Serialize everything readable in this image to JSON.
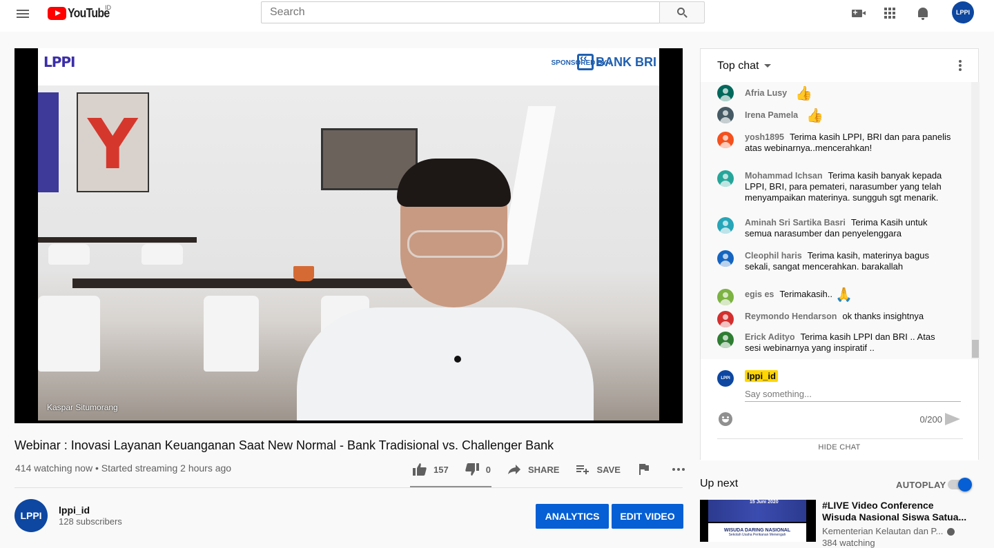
{
  "masthead": {
    "logo_text": "YouTube",
    "country_code": "ID",
    "search_placeholder": "Search",
    "avatar_text": "LPPI"
  },
  "player": {
    "banner_logo": "LPPI",
    "sponsor_label": "SPONSORED BY :",
    "sponsor_name": "BANK BRI",
    "speaker_name": "Kaspar Situmorang"
  },
  "video": {
    "title": "Webinar : Inovasi Layanan Keuanganan Saat New Normal - Bank Tradisional vs. Challenger Bank",
    "meta": "414 watching now • Started streaming 2 hours ago",
    "likes": "157",
    "dislikes": "0",
    "share_label": "SHARE",
    "save_label": "SAVE",
    "like_ratio": 1.0
  },
  "channel": {
    "avatar_text": "LPPI",
    "name": "lppi_id",
    "subscribers": "128 subscribers",
    "analytics_label": "ANALYTICS",
    "edit_label": "EDIT VIDEO"
  },
  "chat": {
    "title": "Top chat",
    "messages": [
      {
        "author": "Afria Lusy",
        "text": "",
        "emoji": "👍",
        "color": "#00695c"
      },
      {
        "author": "Irena Pamela",
        "text": "",
        "emoji": "👍",
        "color": "#455a64"
      },
      {
        "author": "yosh1895",
        "text": "Terima kasih LPPI, BRI dan para panelis atas webinarnya..mencerahkan!",
        "emoji": "",
        "color": "#f4511e"
      },
      {
        "author": "Mohammad Ichsan",
        "text": "Terima kasih banyak kepada LPPI, BRI, para pemateri, narasumber yang telah menyampaikan materinya. sungguh sgt menarik.",
        "emoji": "",
        "color": "#26a69a"
      },
      {
        "author": "Aminah Sri Sartika Basri",
        "text": "Terima Kasih untuk semua narasumber dan penyelenggara",
        "emoji": "",
        "color": "#26a6b8"
      },
      {
        "author": "Cleophil haris",
        "text": "Terima kasih, materinya bagus sekali, sangat mencerahkan. barakallah",
        "emoji": "",
        "color": "#1565c0"
      },
      {
        "author": "egis es",
        "text": "Terimakasih..",
        "emoji": "🙏",
        "color": "#7cb342"
      },
      {
        "author": "Reymondo Hendarson",
        "text": "ok thanks insightnya",
        "emoji": "",
        "color": "#d32f2f"
      },
      {
        "author": "Erick Adityo",
        "text": "Terima kasih LPPI dan BRI .. Atas sesi webinarnya yang inspiratif ..",
        "emoji": "",
        "color": "#2e7d32"
      }
    ],
    "input": {
      "avatar_text": "LPPI",
      "user_name": "lppi_id",
      "placeholder": "Say something...",
      "counter": "0/200"
    },
    "hide_chat_label": "HIDE CHAT"
  },
  "up_next": {
    "label": "Up next",
    "autoplay_label": "AUTOPLAY",
    "autoplay_on": true,
    "items": [
      {
        "title": "#LIVE Video Conference Wisuda Nasional Siswa Satua...",
        "channel": "Kementerian Kelautan dan P...",
        "meta": "384 watching",
        "thumb_date": "15 Juni 2020",
        "thumb_heading": "WISUDA DARING NASIONAL",
        "thumb_sub": "Sekolah Usaha Perikanan Menengah"
      }
    ]
  }
}
